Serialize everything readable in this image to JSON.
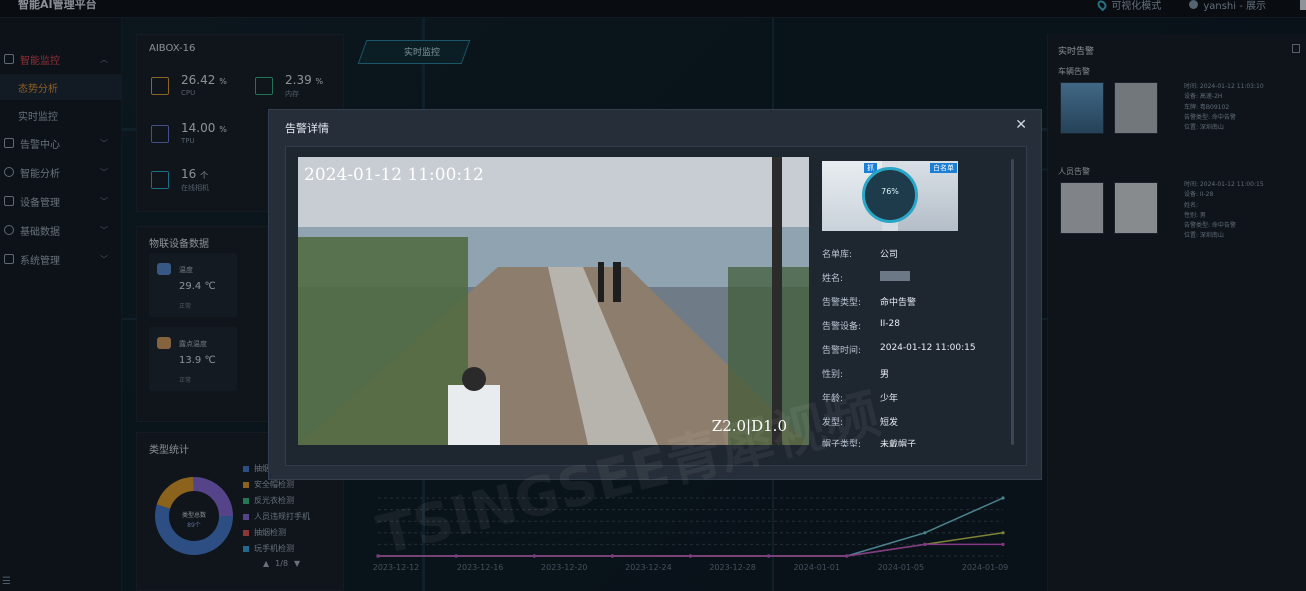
{
  "app": {
    "title": "智能AI管理平台"
  },
  "topbar": {
    "visual_mode": "可视化模式",
    "user": "yanshi - 展示"
  },
  "sidebar": {
    "items": [
      {
        "label": "智能监控",
        "active": true
      },
      {
        "label": "态势分析",
        "sub": true,
        "selected": true
      },
      {
        "label": "实时监控",
        "sub": true
      },
      {
        "label": "告警中心"
      },
      {
        "label": "智能分析"
      },
      {
        "label": "设备管理"
      },
      {
        "label": "基础数据"
      },
      {
        "label": "系统管理"
      }
    ]
  },
  "realtime_label": "实时监控",
  "device_panel": {
    "title": "AIBOX-16",
    "metrics": [
      {
        "value": "26.42",
        "unit": "%",
        "label": "CPU",
        "color": "#e3a33b"
      },
      {
        "value": "2.39",
        "unit": "%",
        "label": "内存",
        "color": "#39b98a"
      },
      {
        "value": "14.00",
        "unit": "%",
        "label": "TPU",
        "color": "#6f7fe0"
      },
      {
        "value": "16",
        "unit": "个",
        "label": "在线相机",
        "color": "#2fb0d4"
      }
    ]
  },
  "iot_panel": {
    "title": "物联设备数据",
    "devices": [
      {
        "name": "温度",
        "value": "29.4 ℃",
        "status": "正常",
        "color": "#5a8fd6"
      },
      {
        "name": "露点温度",
        "value": "13.9 ℃",
        "status": "正常",
        "color": "#d9a066"
      }
    ]
  },
  "type_panel": {
    "title": "类型统计",
    "center_label": "类型总数",
    "center_value": "89个",
    "legend": [
      {
        "label": "抽烟",
        "color": "#4a7fd4"
      },
      {
        "label": "安全帽检测",
        "color": "#e0a030"
      },
      {
        "label": "反光衣检测",
        "color": "#3cbf8a"
      },
      {
        "label": "人员违规打手机",
        "color": "#8b6fe0"
      },
      {
        "label": "抽烟检测",
        "color": "#e05a5a"
      },
      {
        "label": "玩手机检测",
        "color": "#3aa8e0"
      }
    ],
    "pager": "1/8"
  },
  "right_panel": {
    "title": "实时告警",
    "vehicle_section": "车辆告警",
    "vehicle_info": [
      "时间: 2024-01-12 11:03:10",
      "设备: 高速-2H",
      "车牌: 粤B09102",
      "告警类型: 命中告警",
      "位置: 深圳南山"
    ],
    "person_section": "人员告警",
    "person_info": [
      "时间: 2024-01-12 11:00:15",
      "设备: II-28",
      "姓名:",
      "性别: 男",
      "告警类型: 命中告警",
      "位置: 深圳南山"
    ]
  },
  "chart_data": {
    "type": "line",
    "categories": [
      "2023-12-12",
      "2023-12-16",
      "2023-12-20",
      "2023-12-24",
      "2023-12-28",
      "2024-01-01",
      "2024-01-05",
      "2024-01-09"
    ],
    "series": [
      {
        "values": [
          0,
          0,
          0,
          0,
          0,
          0,
          0,
          2,
          5
        ],
        "color": "#7ad3e8"
      },
      {
        "values": [
          0,
          0,
          0,
          0,
          0,
          0,
          0,
          1,
          2
        ],
        "color": "#c9d25a"
      },
      {
        "values": [
          0,
          0,
          0,
          0,
          0,
          0,
          0,
          1,
          1
        ],
        "color": "#d35ad8"
      }
    ],
    "ylim": [
      0,
      5
    ],
    "grid": true
  },
  "modal": {
    "title": "告警详情",
    "timestamp": "2024-01-12 11:00:12",
    "zoom": "Z2.0|D1.0",
    "face": {
      "match": "76%",
      "tag_left": "抓",
      "tag_right": "白名单"
    },
    "fields": [
      {
        "k": "名单库:",
        "v": "公司"
      },
      {
        "k": "姓名:",
        "v": ""
      },
      {
        "k": "告警类型:",
        "v": "命中告警"
      },
      {
        "k": "告警设备:",
        "v": "II-28"
      },
      {
        "k": "告警时间:",
        "v": "2024-01-12 11:00:15"
      },
      {
        "k": "性别:",
        "v": "男"
      },
      {
        "k": "年龄:",
        "v": "少年"
      },
      {
        "k": "发型:",
        "v": "短发"
      },
      {
        "k": "帽子类型:",
        "v": "未戴帽子"
      }
    ]
  },
  "watermark": "TSINGSEE青犀视频"
}
